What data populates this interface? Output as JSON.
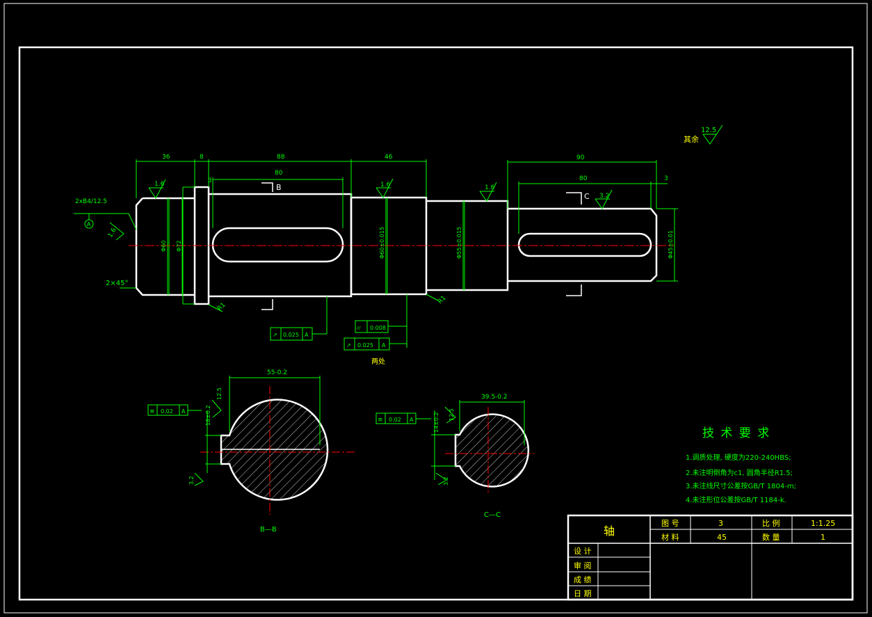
{
  "colors": {
    "background": "#000000",
    "outline": "#ffffff",
    "dimension": "#00ff00",
    "centerline": "#ff0000",
    "title_text": "#ffff00"
  },
  "surface_roughness_rest": {
    "label": "其余",
    "value": "12.5"
  },
  "dimensions": {
    "len_36": "36",
    "len_8": "8",
    "len_88": "88",
    "len_80a": "80",
    "len_3a": "3",
    "len_46": "46",
    "len_90": "90",
    "len_80b": "80",
    "len_3b": "3",
    "chamfer": "2×45°",
    "center_hole": "2xB4/12.5",
    "center_hole_ref": "A",
    "dia_60": "Φ60",
    "dia_72": "Φ72",
    "dia_seg3": "Φ60±0.015",
    "dia_seg4": "Φ55±0.015",
    "dia_seg5": "Φ45±0.01",
    "radius_1": "R1",
    "radius_2": "R1",
    "rough_1": "1.6",
    "rough_2": "1.6",
    "rough_3": "1.6",
    "rough_4": "3.2",
    "rough_5": "1.6"
  },
  "section_labels": {
    "b_mark": "B",
    "c_mark": "C"
  },
  "tolerance_frames": [
    {
      "symbol": "↗",
      "value": "0.025",
      "datum": "A"
    },
    {
      "symbol": "⌭",
      "value": "0.008",
      "datum": ""
    },
    {
      "symbol": "↗",
      "value": "0.025",
      "datum": "A"
    }
  ],
  "two_places": "两处",
  "section_bb": {
    "width_dim": "55-0.2",
    "keyway_tol": "18±0.2",
    "rough_a": "12.5",
    "rough_b": "3.2",
    "frame_symbol": "≡",
    "frame_value": "0.02",
    "frame_datum": "A",
    "caption": "B—B"
  },
  "section_cc": {
    "width_dim": "39.5-0.2",
    "keyway_tol": "14±0.2",
    "rough_a": "12.5",
    "rough_b": "3.2",
    "frame_symbol": "≡",
    "frame_value": "0.02",
    "frame_datum": "A",
    "caption": "C—C"
  },
  "tech_requirements": {
    "title": "技 术 要 求",
    "items": [
      "1.调质处理, 硬度为220-240HBS;",
      "2.未注明倒角为c1, 圆角半径R1.5;",
      "3.未注线尺寸公差按GB/T 1804-m;",
      "4.未注形位公差按GB/T 1184-k."
    ]
  },
  "title_block": {
    "part_name": "轴",
    "drawing_no_label": "图 号",
    "drawing_no": "3",
    "scale_label": "比 例",
    "scale": "1:1.25",
    "material_label": "材 料",
    "material": "45",
    "quantity_label": "数 量",
    "quantity": "1",
    "design": "设 计",
    "review": "审 阅",
    "grade": "成 绩",
    "date": "日 期"
  }
}
